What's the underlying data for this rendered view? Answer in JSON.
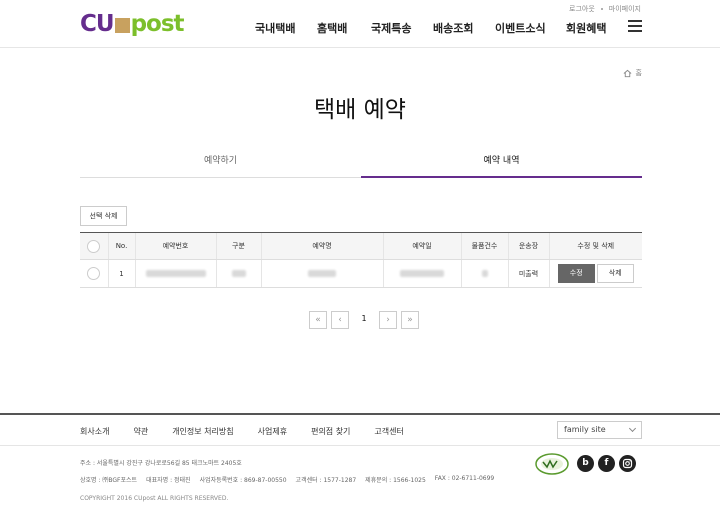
{
  "header": {
    "logo": {
      "left": "CU",
      "right": "post"
    },
    "util_links": [
      "로그아웃",
      "마이페이지"
    ],
    "nav": [
      "국내택배",
      "홈택배",
      "국제특송",
      "배송조회",
      "이벤트소식",
      "회원혜택"
    ]
  },
  "breadcrumb": {
    "home": "홈"
  },
  "page_title": "택배 예약",
  "tabs": [
    {
      "label": "예약하기",
      "active": false
    },
    {
      "label": "예약 내역",
      "active": true
    }
  ],
  "actions": {
    "delete_selected": "선택 삭제"
  },
  "table": {
    "headers": [
      "No.",
      "예약번호",
      "구분",
      "예약명",
      "예약일",
      "물품건수",
      "운송장",
      "수정 및 삭제"
    ],
    "rows": [
      {
        "no": "1",
        "waybill": "미출력",
        "edit": "수정",
        "delete": "삭제"
      }
    ]
  },
  "pagination": {
    "current": "1"
  },
  "footer": {
    "links": [
      "회사소개",
      "약관",
      "개인정보 처리방침",
      "사업제휴",
      "편의점 찾기",
      "고객센터"
    ],
    "family_site": "family site",
    "address": "주소 : 서울특별시 강진구 강나로로56길 85 태크노마트 2405호",
    "info": [
      "상호명 : ㈜BGF포스트",
      "대표자명 : 정태진",
      "사업자등록번호 : 869-87-00550",
      "고객센터 : 1577-1287",
      "제휴문의 : 1566-1025",
      "FAX : 02-6711-0699"
    ],
    "copyright": "COPYRIGHT 2016 CUpost ALL RIGHTS RESERVED.",
    "sns": [
      "b",
      "f",
      "instagram"
    ]
  },
  "colors": {
    "accent": "#652d8d",
    "logo_green": "#7cbf2b",
    "logo_box": "#c8a15f"
  }
}
